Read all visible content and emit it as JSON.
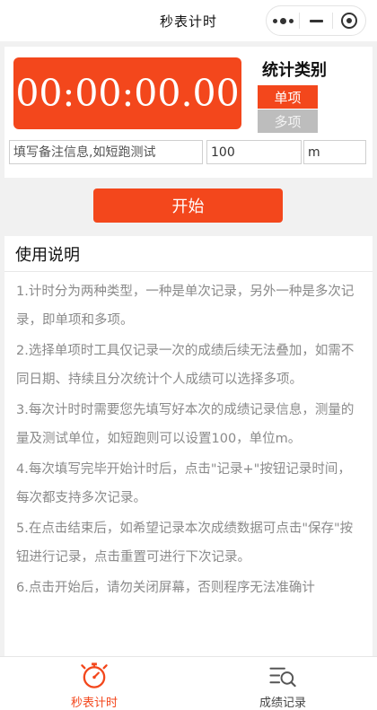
{
  "navbar": {
    "title": "秒表计时"
  },
  "timer": {
    "display": "00:00:00.00"
  },
  "stat_type": {
    "title": "统计类别",
    "options": [
      "单项",
      "多项"
    ],
    "selected": "单项"
  },
  "inputs": {
    "note_placeholder": "填写备注信息,如短跑测试",
    "amount_value": "100",
    "unit_value": "m"
  },
  "start_button": {
    "label": "开始"
  },
  "instructions": {
    "title": "使用说明",
    "items": [
      "1.计时分为两种类型，一种是单次记录，另外一种是多次记录，即单项和多项。",
      "2.选择单项时工具仅记录一次的成绩后续无法叠加，如需不同日期、持续且分次统计个人成绩可以选择多项。",
      "3.每次计时时需要您先填写好本次的成绩记录信息，测量的量及测试单位，如短跑则可以设置100，单位m。",
      "4.每次填写完毕开始计时后，点击\"记录+\"按钮记录时间，每次都支持多次记录。",
      "5.在点击结束后，如希望记录本次成绩数据可点击\"保存\"按钮进行记录，点击重置可进行下次记录。",
      "6.点击开始后，请勿关闭屏幕，否则程序无法准确计"
    ]
  },
  "tabbar": {
    "tabs": [
      {
        "label": "秒表计时",
        "icon": "stopwatch-icon",
        "active": true
      },
      {
        "label": "成绩记录",
        "icon": "records-search-icon",
        "active": false
      }
    ]
  },
  "colors": {
    "accent": "#f3471c",
    "inactive_option": "#bdbdbd",
    "instruction_text": "#8a8a8a"
  }
}
